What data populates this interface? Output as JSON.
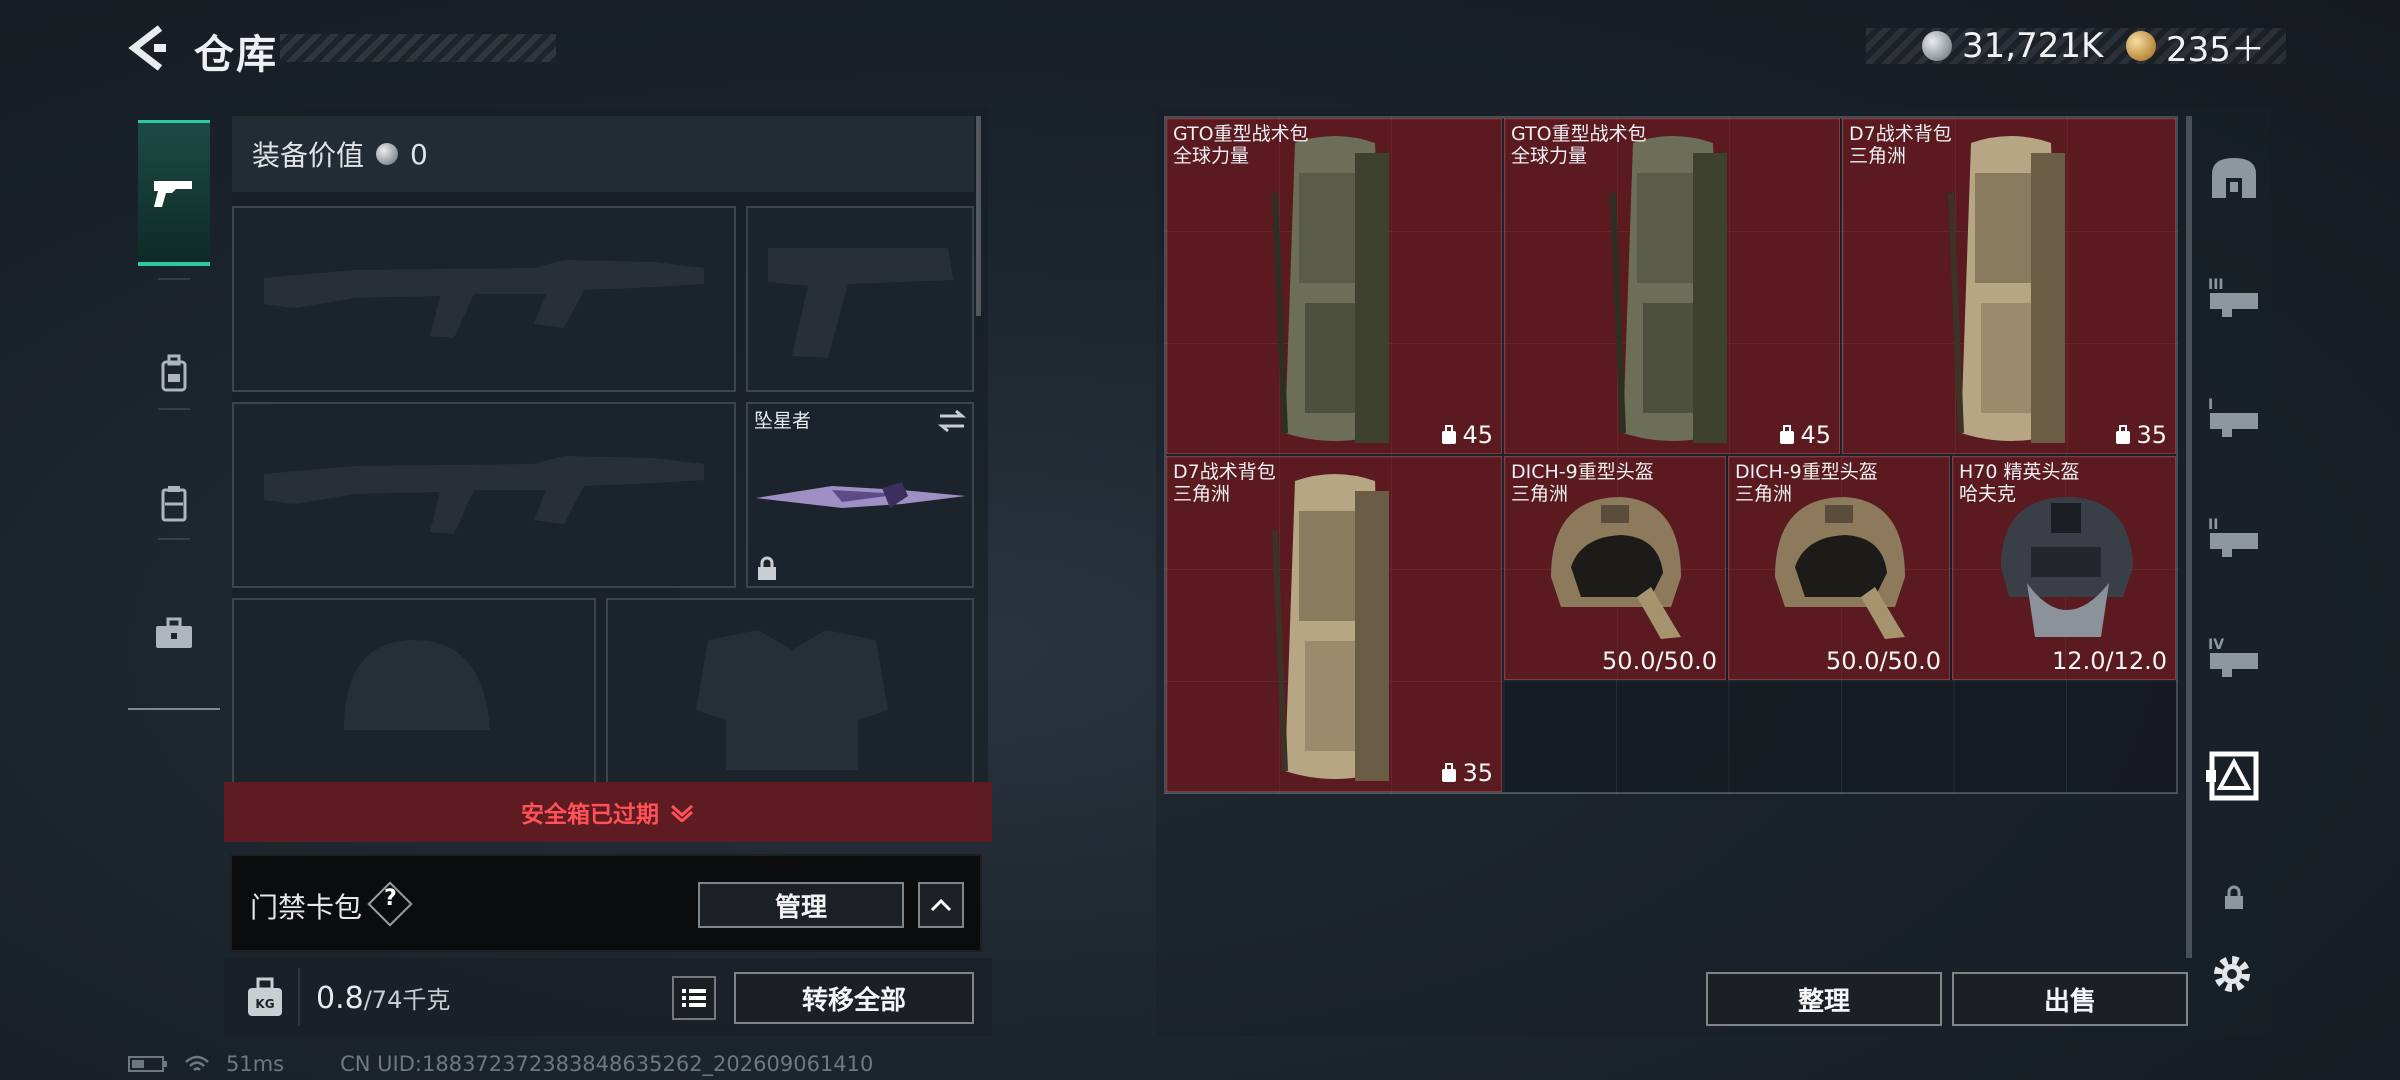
{
  "header": {
    "title": "仓库",
    "currency": [
      {
        "icon": "silver-coin-icon",
        "value": "31,721K"
      },
      {
        "icon": "gold-coin-icon",
        "value": "235＋"
      }
    ]
  },
  "left_tabs": [
    {
      "icon": "pistol-icon",
      "active": true
    },
    {
      "icon": "backpack-icon",
      "active": false
    },
    {
      "icon": "vest-icon",
      "active": false
    },
    {
      "icon": "briefcase-icon",
      "active": false
    }
  ],
  "loadout": {
    "value_label": "装备价值",
    "value": "0",
    "knife_name": "坠星者"
  },
  "safebox": {
    "label": "安全箱已过期"
  },
  "keycard": {
    "label": "门禁卡包",
    "help": "?",
    "manage_label": "管理"
  },
  "weight": {
    "current": "0.8",
    "max": "/74千克",
    "transfer_label": "转移全部"
  },
  "status": {
    "ping": "51ms",
    "uid": "CN UID:188372372383848635262_202609061410"
  },
  "storage": {
    "items": [
      {
        "name": "GTO重型战术包",
        "origin": "全球力量",
        "stat": "45",
        "stat_type": "capacity"
      },
      {
        "name": "GTO重型战术包",
        "origin": "全球力量",
        "stat": "45",
        "stat_type": "capacity"
      },
      {
        "name": "D7战术背包",
        "origin": "三角洲",
        "stat": "35",
        "stat_type": "capacity"
      },
      {
        "name": "D7战术背包",
        "origin": "三角洲",
        "stat": "35",
        "stat_type": "capacity"
      },
      {
        "name": "DICH-9重型头盔",
        "origin": "三角洲",
        "stat": "50.0/50.0",
        "stat_type": "durability"
      },
      {
        "name": "DICH-9重型头盔",
        "origin": "三角洲",
        "stat": "50.0/50.0",
        "stat_type": "durability"
      },
      {
        "name": "H70 精英头盔",
        "origin": "哈夫克",
        "stat": "12.0/12.0",
        "stat_type": "durability"
      }
    ],
    "sort_label": "整理",
    "sell_label": "出售"
  },
  "right_tabs": [
    {
      "icon": "safe-icon"
    },
    {
      "icon": "storage-3-icon"
    },
    {
      "icon": "storage-1-icon"
    },
    {
      "icon": "storage-2-icon"
    },
    {
      "icon": "storage-4-icon"
    },
    {
      "icon": "storage-all-icon",
      "active": true
    },
    {
      "icon": "lock-icon"
    }
  ],
  "colors": {
    "accent": "#2ccaa0",
    "alert": "#ff5157",
    "item_bg": "#5a1a20"
  }
}
